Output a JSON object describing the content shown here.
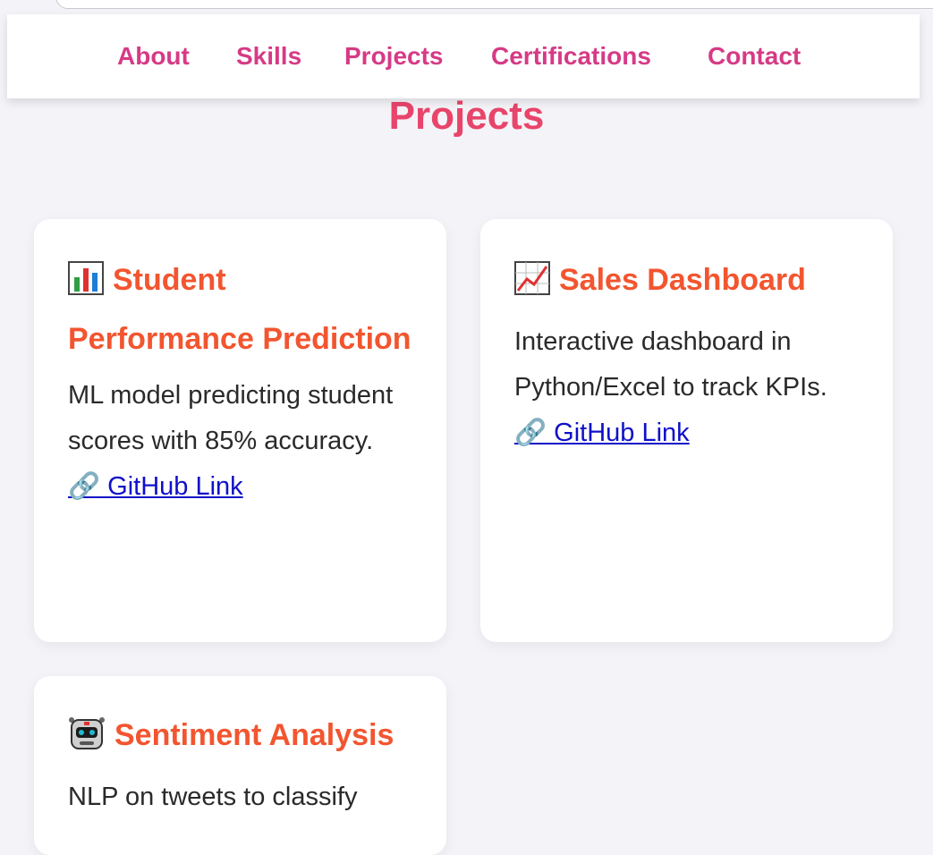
{
  "nav": {
    "links": [
      "About",
      "Skills",
      "Projects",
      "Certifications",
      "Contact"
    ]
  },
  "section": {
    "title": "Projects"
  },
  "projects": [
    {
      "icon": "bar-chart-icon",
      "title": "Student Performance Prediction",
      "description": "ML model predicting student scores with 85% accuracy.",
      "link_label": "🔗 GitHub Link"
    },
    {
      "icon": "chart-increasing-icon",
      "title": "Sales Dashboard",
      "description": "Interactive dashboard in Python/Excel to track KPIs.",
      "link_label": "🔗 GitHub Link"
    },
    {
      "icon": "robot-icon",
      "title": "Sentiment Analysis",
      "description": "NLP on tweets to classify"
    }
  ],
  "colors": {
    "nav_link": "#d63a86",
    "section_title": "#e8456a",
    "card_title": "#f2552f",
    "link": "#1010c8",
    "background": "#f4f3f8"
  }
}
